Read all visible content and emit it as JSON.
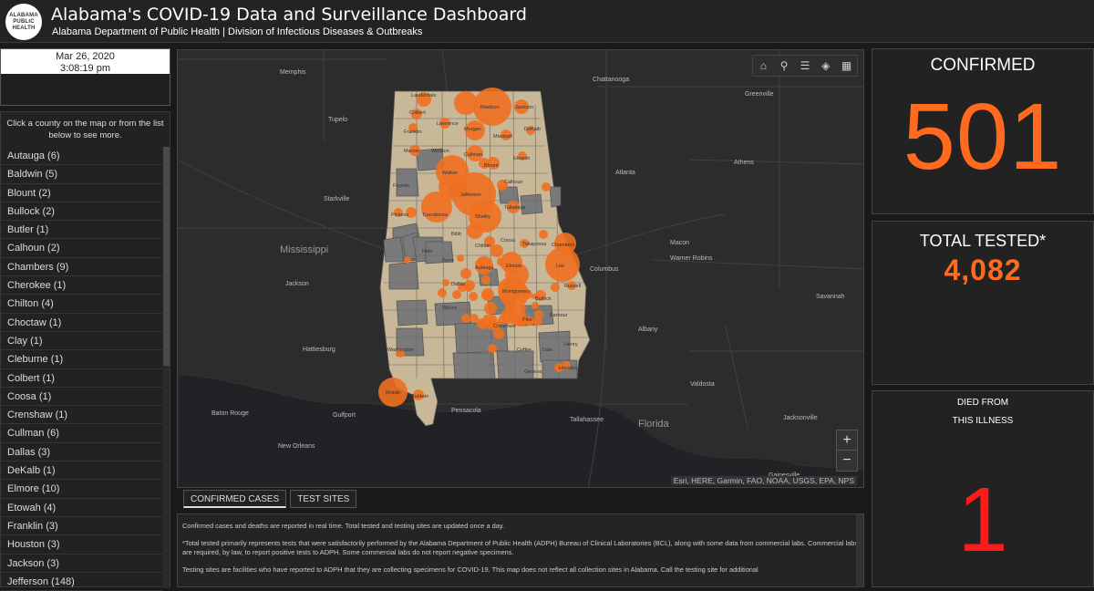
{
  "header": {
    "logo_lines": [
      "ALABAMA",
      "PUBLIC",
      "HEALTH"
    ],
    "title": "Alabama's COVID-19 Data and Surveillance Dashboard",
    "subtitle": "Alabama Department of Public Health | Division of Infectious Diseases & Outbreaks"
  },
  "date_box": {
    "date": "Mar 26, 2020",
    "time": "3:08:19 pm"
  },
  "county_panel": {
    "hint": "Click a county on the map or from the list below to see more.",
    "counties": [
      {
        "name": "Autauga",
        "count": "(6)"
      },
      {
        "name": "Baldwin",
        "count": "(5)"
      },
      {
        "name": "Blount",
        "count": "(2)"
      },
      {
        "name": "Bullock",
        "count": "(2)"
      },
      {
        "name": "Butler",
        "count": "(1)"
      },
      {
        "name": "Calhoun",
        "count": "(2)"
      },
      {
        "name": "Chambers",
        "count": "(9)"
      },
      {
        "name": "Cherokee",
        "count": "(1)"
      },
      {
        "name": "Chilton",
        "count": "(4)"
      },
      {
        "name": "Choctaw",
        "count": "(1)"
      },
      {
        "name": "Clay",
        "count": "(1)"
      },
      {
        "name": "Cleburne",
        "count": "(1)"
      },
      {
        "name": "Colbert",
        "count": "(1)"
      },
      {
        "name": "Coosa",
        "count": "(1)"
      },
      {
        "name": "Crenshaw",
        "count": "(1)"
      },
      {
        "name": "Cullman",
        "count": "(6)"
      },
      {
        "name": "Dallas",
        "count": "(3)"
      },
      {
        "name": "DeKalb",
        "count": "(1)"
      },
      {
        "name": "Elmore",
        "count": "(10)"
      },
      {
        "name": "Etowah",
        "count": "(4)"
      },
      {
        "name": "Franklin",
        "count": "(3)"
      },
      {
        "name": "Houston",
        "count": "(3)"
      },
      {
        "name": "Jackson",
        "count": "(3)"
      },
      {
        "name": "Jefferson",
        "count": "(148)"
      }
    ]
  },
  "map": {
    "labels": {
      "memphis": "Memphis",
      "chattanooga": "Chattanooga",
      "mississippi": "Mississippi",
      "jackson_ms": "Jackson",
      "hattiesburg": "Hattiesburg",
      "gulfport": "Gulfport",
      "pensacola": "Pensacola",
      "tallahassee": "Tallahassee",
      "florida": "Florida",
      "atlanta": "Atlanta",
      "athens": "Athens",
      "macon": "Macon",
      "columbus": "Columbus",
      "albany": "Albany",
      "savannah": "Savannah",
      "valdosta": "Valdosta",
      "jacksonville": "Jacksonville",
      "gainesville": "Gainesville",
      "new_orleans": "New Orleans",
      "baton_rouge": "Baton Rouge",
      "starkville": "Starkville",
      "tupelo": "Tupelo",
      "greenville": "Greenville",
      "warner_robins": "Warner Robins"
    },
    "county_labels": {
      "lauderdale": "Lauderdale",
      "madison": "Madison",
      "jackson": "Jackson",
      "colbert": "Colbert",
      "lawrence": "Lawrence",
      "morgan": "Morgan",
      "marshall": "Marshall",
      "dekalb": "DeKalb",
      "franklin": "Franklin",
      "cullman": "Cullman",
      "marion": "Marion",
      "winston": "Winston",
      "etowah": "Etowah",
      "walker": "Walker",
      "blount": "Blount",
      "fayette": "Fayette",
      "jefferson": "Jefferson",
      "calhoun": "Calhoun",
      "tuscaloosa": "Tuscaloosa",
      "shelby": "Shelby",
      "talladega": "Talladega",
      "pickens": "Pickens",
      "bibb": "Bibb",
      "coosa": "Coosa",
      "chilton": "Chilton",
      "tallapoosa": "Tallapoosa",
      "chambers": "Chambers",
      "autauga": "Autauga",
      "elmore": "Elmore",
      "lee": "Lee",
      "dallas": "Dallas",
      "montgomery": "Montgomery",
      "bullock": "Bullock",
      "russell": "Russell",
      "wilcox": "Wilcox",
      "crenshaw": "Crenshaw",
      "pike": "Pike",
      "barbour": "Barbour",
      "washington": "Washington",
      "coffee": "Coffee",
      "dale": "Dale",
      "henry": "Henry",
      "houston": "Houston",
      "geneva": "Geneva",
      "mobile": "Mobile",
      "baldwin": "Baldwin",
      "hale": "Hale",
      "perry": "Perry"
    },
    "tools": [
      "home-icon",
      "search-icon",
      "list-icon",
      "layers-icon",
      "qr-icon"
    ],
    "zoom_in": "+",
    "zoom_out": "−",
    "attribution": "Esri, HERE, Garmin, FAO, NOAA, USGS, EPA, NPS"
  },
  "tabs": [
    "CONFIRMED CASES",
    "TEST SITES"
  ],
  "notes": [
    "Confirmed cases and deaths are reported in real time. Total tested and testing sites are updated once a day.",
    "*Total tested primarily represents tests that were satisfactorily performed by the Alabama Department of Public Health (ADPH) Bureau of Clinical Laboratories (BCL), along with some data from commercial labs. Commercial labs are required, by law, to report positive tests to ADPH. Some commercial labs do not report negative specimens.",
    "Testing sites are facilities who have reported to ADPH that they are collecting specimens for COVID-19. This map does not reflect all collection sites in Alabama. Call the testing site for additional"
  ],
  "stats": {
    "confirmed_label": "CONFIRMED",
    "confirmed_value": "501",
    "tested_label": "TOTAL TESTED*",
    "tested_value": "4,082",
    "died_label_1": "DIED FROM",
    "died_label_2": "THIS ILLNESS",
    "died_value": "1"
  },
  "colors": {
    "accent_orange": "#ff6a1f",
    "death_red": "#ff1a1a",
    "county_case": "#c8b898",
    "county_nocase": "#7a7a7a"
  }
}
